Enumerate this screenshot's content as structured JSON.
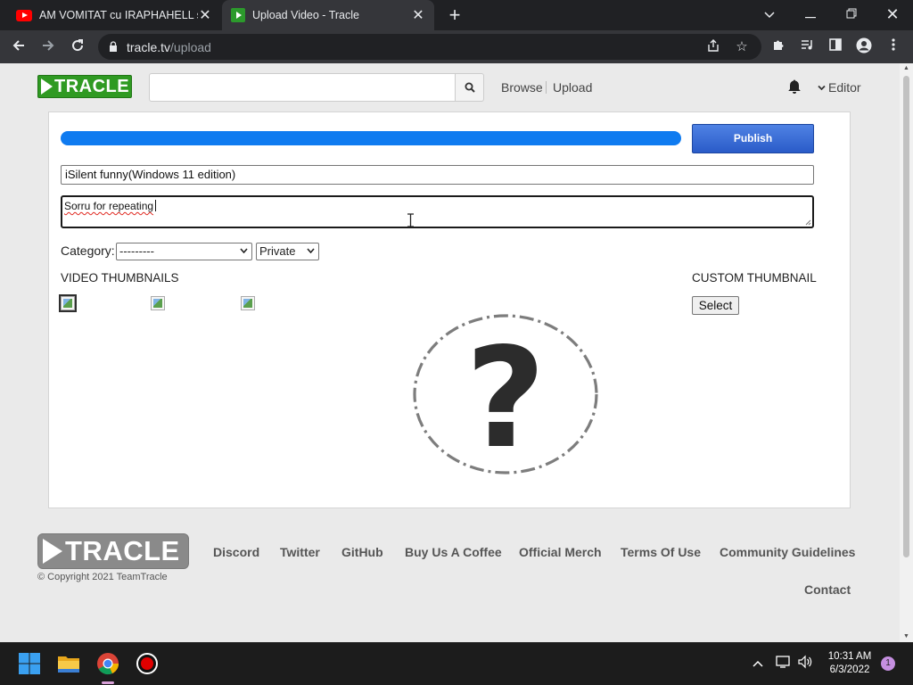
{
  "browser": {
    "tabs": [
      {
        "title": "AM VOMITAT cu IRAPHAHELL si l",
        "icon": "youtube-icon"
      },
      {
        "title": "Upload Video - Tracle",
        "icon": "tracle-icon"
      }
    ],
    "url_host": "tracle.tv",
    "url_path": "/upload"
  },
  "header": {
    "logo_text": "TRACLE",
    "search_placeholder": "",
    "nav": {
      "browse": "Browse",
      "upload": "Upload"
    },
    "user_menu": "Editor"
  },
  "upload": {
    "progress_percent": 100,
    "publish_label": "Publish",
    "title_value": "iSilent funny(Windows 11 edition)",
    "description_value": "Sorru for repeating",
    "category_label": "Category:",
    "category_value": "---------",
    "privacy_value": "Private",
    "video_thumbnails_label": "VIDEO THUMBNAILS",
    "custom_thumbnail_label": "CUSTOM THUMBNAIL",
    "select_label": "Select",
    "placeholder_glyph": "?"
  },
  "footer": {
    "logo_text": "TRACLE",
    "copyright": "© Copyright 2021 TeamTracle",
    "links": [
      "Discord",
      "Twitter",
      "GitHub",
      "Buy Us A Coffee",
      "Official Merch",
      "Terms Of Use",
      "Community Guidelines",
      "Contact"
    ]
  },
  "taskbar": {
    "time": "10:31 AM",
    "date": "6/3/2022",
    "notifications": "1"
  },
  "colors": {
    "brand_green": "#2f9a22",
    "progress_blue": "#0f7bf0",
    "publish_blue": "#2a5bc8"
  }
}
